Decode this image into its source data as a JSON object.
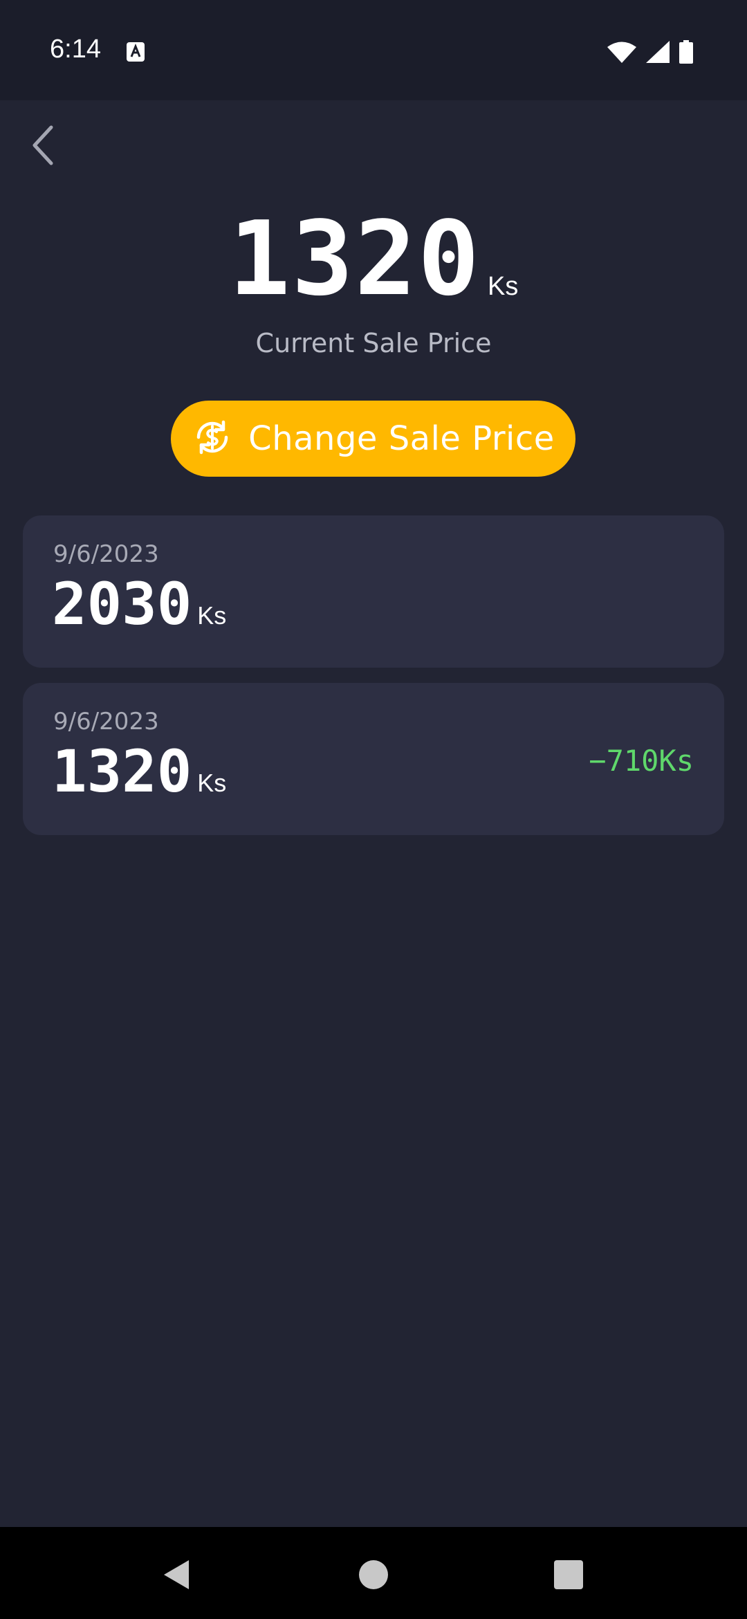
{
  "status_bar": {
    "time": "6:14",
    "icons": [
      "a-notification-icon",
      "wifi-icon",
      "cellular-signal-icon",
      "battery-icon"
    ]
  },
  "header": {
    "back_icon": "chevron-left-icon"
  },
  "current_price": {
    "value": "1320",
    "unit": "Ks",
    "caption": "Current Sale Price"
  },
  "change_button": {
    "label": "Change Sale Price",
    "icon": "dollar-refresh-icon"
  },
  "history": [
    {
      "date": "9/6/2023",
      "price": "2030",
      "unit": "Ks",
      "diff": ""
    },
    {
      "date": "9/6/2023",
      "price": "1320",
      "unit": "Ks",
      "diff": "−710Ks"
    }
  ],
  "nav_bar": {
    "icons": [
      "nav-back-icon",
      "nav-home-icon",
      "nav-recents-icon"
    ]
  },
  "colors": {
    "background": "#222433",
    "status_bar": "#1b1d2a",
    "card": "#2d2f43",
    "accent": "#ffb800",
    "diff_positive": "#5fd86b",
    "muted_text": "#a8aab6"
  }
}
